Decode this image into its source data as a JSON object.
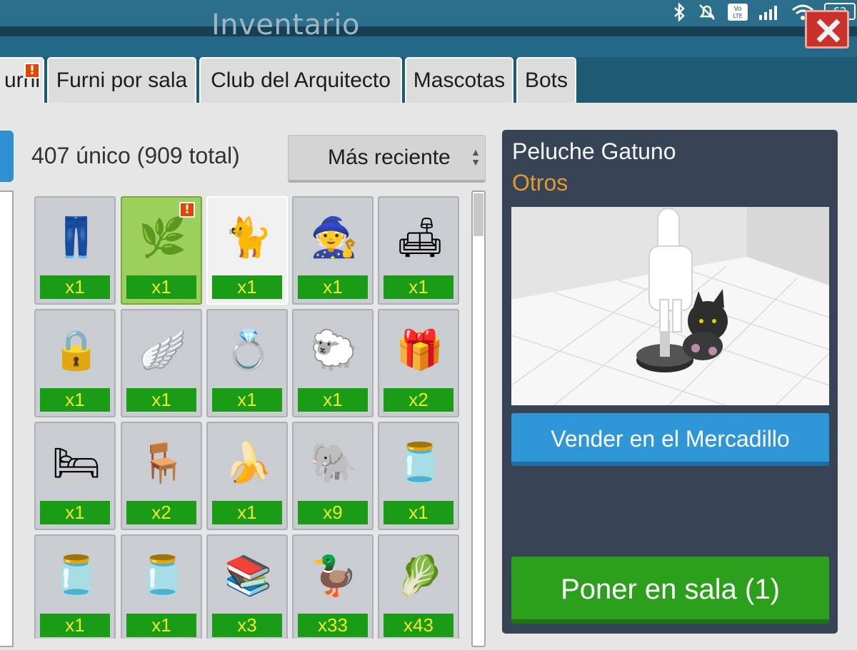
{
  "window": {
    "title": "Inventario"
  },
  "status_bar": {
    "battery": "62",
    "network": "VoLTE"
  },
  "tabs": [
    {
      "label": "urni",
      "alert": "!"
    },
    {
      "label": "Furni por sala"
    },
    {
      "label": "Club del Arquitecto"
    },
    {
      "label": "Mascotas"
    },
    {
      "label": "Bots"
    }
  ],
  "inventory": {
    "count_label": "407 único (909 total)",
    "sort_value": "Más reciente",
    "items": [
      {
        "icon": "pants-icon",
        "qty": "x1",
        "state": "normal"
      },
      {
        "icon": "scattered-leaves-icon",
        "qty": "x1",
        "state": "green",
        "alert": "!"
      },
      {
        "icon": "black-cat-plush-icon",
        "qty": "x1",
        "state": "white"
      },
      {
        "icon": "gnome-icon",
        "qty": "x1",
        "state": "normal"
      },
      {
        "icon": "sofa-icon",
        "qty": "x1",
        "state": "normal"
      },
      {
        "icon": "padlock-heart-icon",
        "qty": "x1",
        "state": "normal"
      },
      {
        "icon": "angel-wings-icon",
        "qty": "x1",
        "state": "normal"
      },
      {
        "icon": "ring-icon",
        "qty": "x1",
        "state": "normal"
      },
      {
        "icon": "sheep-hanger-icon",
        "qty": "x1",
        "state": "normal"
      },
      {
        "icon": "gift-bag-icon",
        "qty": "x2",
        "state": "normal"
      },
      {
        "icon": "bed-icon",
        "qty": "x1",
        "state": "normal"
      },
      {
        "icon": "wooden-chair-icon",
        "qty": "x2",
        "state": "normal"
      },
      {
        "icon": "banana-icon",
        "qty": "x1",
        "state": "normal"
      },
      {
        "icon": "elephant-icon",
        "qty": "x9",
        "state": "normal"
      },
      {
        "icon": "glass-jar-icon",
        "qty": "x1",
        "state": "normal"
      },
      {
        "icon": "glass-jar-icon",
        "qty": "x1",
        "state": "normal"
      },
      {
        "icon": "glass-jar-icon",
        "qty": "x1",
        "state": "normal"
      },
      {
        "icon": "bookshelf-icon",
        "qty": "x3",
        "state": "normal"
      },
      {
        "icon": "rubber-duck-icon",
        "qty": "x33",
        "state": "normal"
      },
      {
        "icon": "cabbage-icon",
        "qty": "x43",
        "state": "normal"
      }
    ]
  },
  "details": {
    "name": "Peluche Gatuno",
    "category": "Otros",
    "sell_button": "Vender en el Mercadillo",
    "place_button": "Poner en sala (1)"
  },
  "colors": {
    "header": "#1d5a73",
    "panel": "#374455",
    "category": "#e09a32",
    "qty_bg": "#1b9c16",
    "qty_text": "#f0ea2c"
  }
}
